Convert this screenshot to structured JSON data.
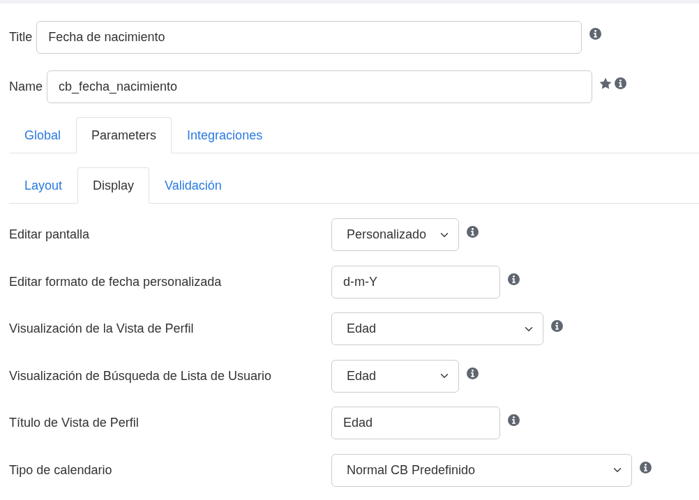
{
  "header_fields": [
    {
      "label": "Title",
      "value": "Fecha de nacimiento",
      "starred": false
    },
    {
      "label": "Name",
      "value": "cb_fecha_nacimiento",
      "starred": true
    }
  ],
  "tabs": [
    {
      "label": "Global",
      "selected": false
    },
    {
      "label": "Parameters",
      "selected": true
    },
    {
      "label": "Integraciones",
      "selected": false
    }
  ],
  "subtabs": [
    {
      "label": "Layout",
      "selected": false
    },
    {
      "label": "Display",
      "selected": true
    },
    {
      "label": "Validación",
      "selected": false
    }
  ],
  "settings": [
    {
      "label": "Editar pantalla",
      "kind": "select",
      "value": "Personalizado"
    },
    {
      "label": "Editar formato de fecha personalizada",
      "kind": "text",
      "value": "d-m-Y"
    },
    {
      "label": "Visualización de la Vista de Perfil",
      "kind": "select",
      "value": "Edad"
    },
    {
      "label": "Visualización de Búsqueda de Lista de Usuario",
      "kind": "select",
      "value": "Edad"
    },
    {
      "label": "Título de Vista de Perfil",
      "kind": "text",
      "value": "Edad"
    },
    {
      "label": "Tipo de calendario",
      "kind": "select",
      "value": "Normal CB Predefinido"
    }
  ]
}
